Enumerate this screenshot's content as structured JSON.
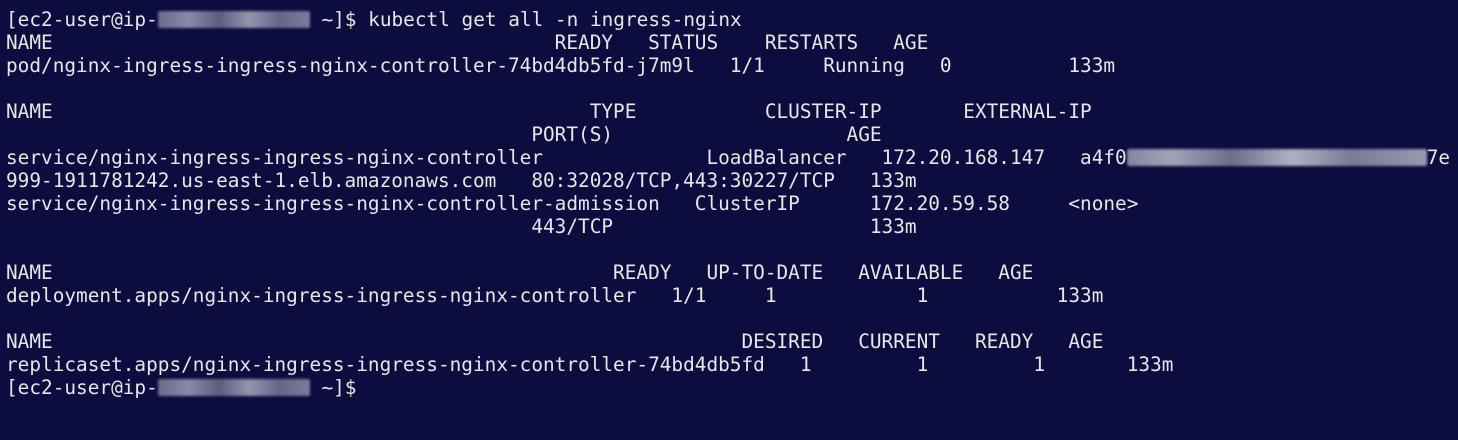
{
  "prompt": {
    "user_prefix": "[ec2-user@ip-",
    "suffix": " ~]$"
  },
  "command": " kubectl get all -n ingress-nginx",
  "pods": {
    "header": "NAME                                           READY   STATUS    RESTARTS   AGE",
    "row": "pod/nginx-ingress-ingress-nginx-controller-74bd4db5fd-j7m9l   1/1     Running   0          133m"
  },
  "services": {
    "header1": "NAME                                              TYPE           CLUSTER-IP       EXTERNAL-IP",
    "header2": "                                             PORT(S)                    AGE",
    "row1a_pre": "service/nginx-ingress-ingress-nginx-controller              LoadBalancer   172.20.168.147   a4f0",
    "row1a_post": "7e",
    "row1b": "999-1911781242.us-east-1.elb.amazonaws.com   80:32028/TCP,443:30227/TCP   133m",
    "row2a": "service/nginx-ingress-ingress-nginx-controller-admission   ClusterIP      172.20.59.58     <none>",
    "row2b": "                                             443/TCP                      133m"
  },
  "deployments": {
    "header": "NAME                                                READY   UP-TO-DATE   AVAILABLE   AGE",
    "row": "deployment.apps/nginx-ingress-ingress-nginx-controller   1/1     1            1           133m"
  },
  "replicasets": {
    "header": "NAME                                                           DESIRED   CURRENT   READY   AGE",
    "row": "replicaset.apps/nginx-ingress-ingress-nginx-controller-74bd4db5fd   1         1         1       133m"
  },
  "colors": {
    "background": "#0c0c3e",
    "foreground": "#e6e6e6"
  }
}
